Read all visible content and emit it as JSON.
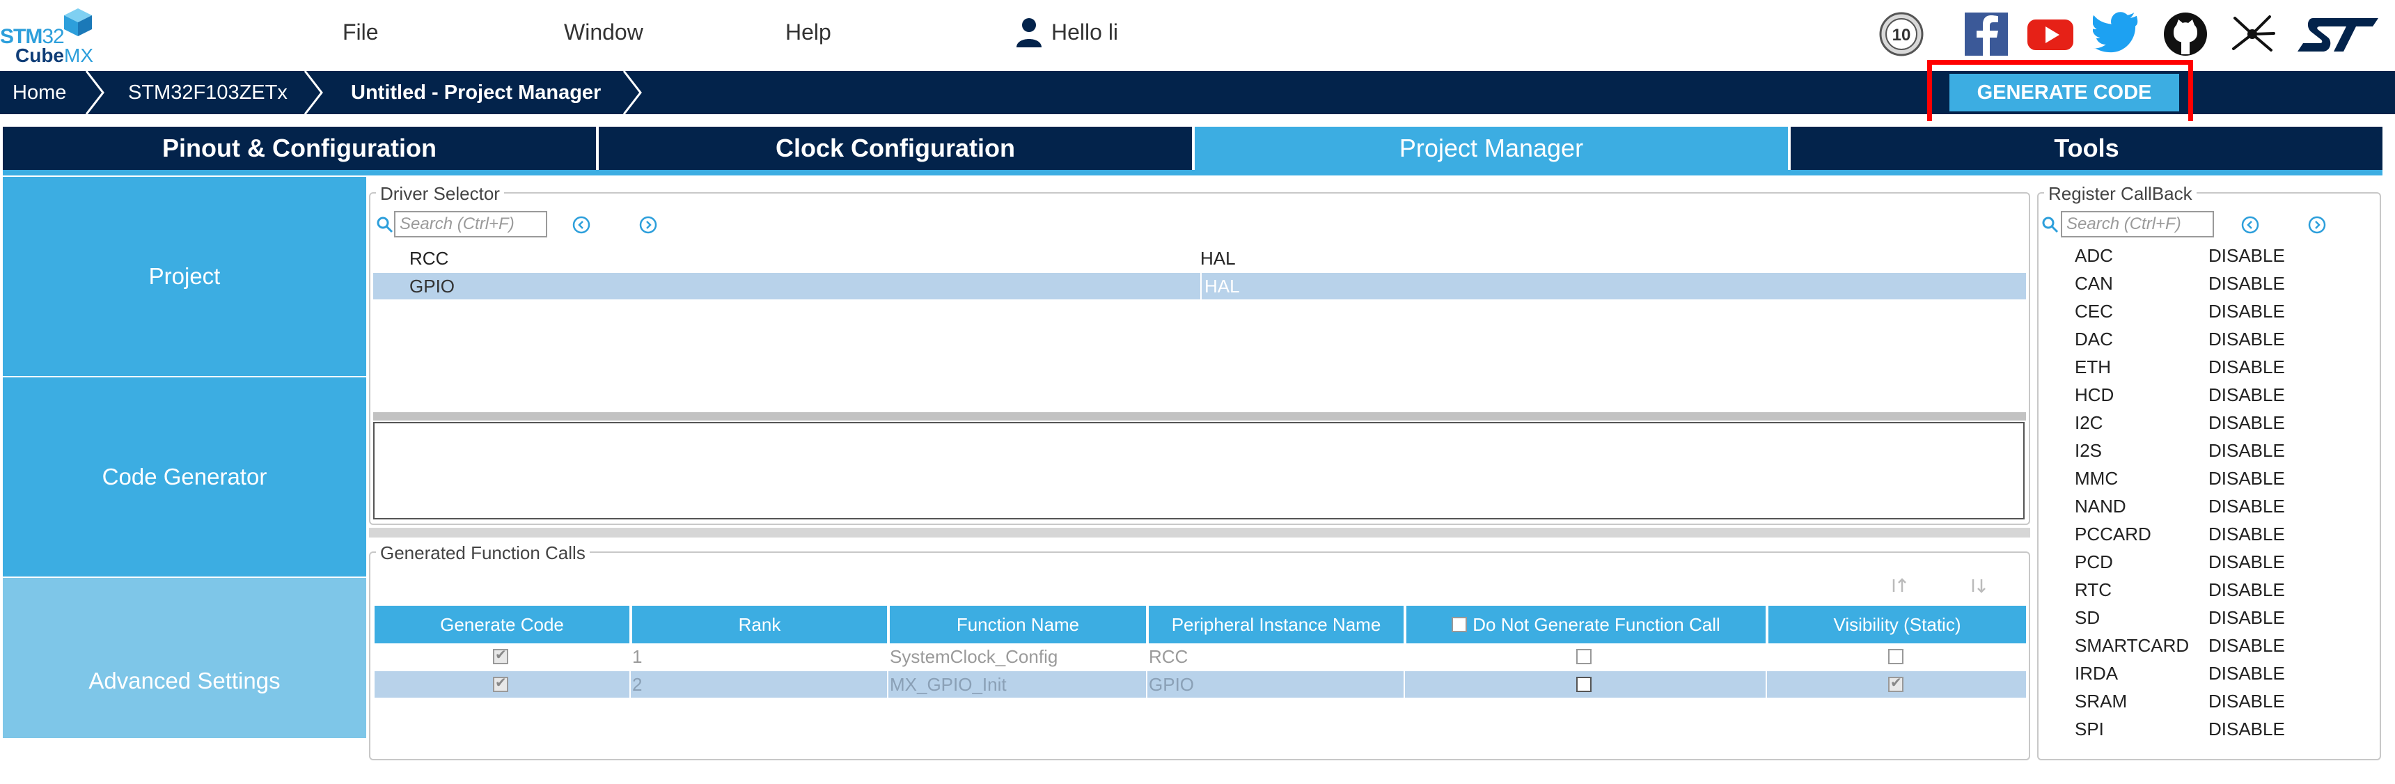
{
  "app": {
    "logo_line1_a": "STM",
    "logo_line1_b": "32",
    "logo_line2_a": "Cube",
    "logo_line2_b": "MX",
    "brand_color": "#3cade2",
    "dark_color": "#03234b"
  },
  "menu": {
    "file": "File",
    "window": "Window",
    "help": "Help",
    "user": "Hello li",
    "user_icon": "user-icon",
    "social_icons": [
      "anniversary-10-badge-icon",
      "facebook-icon",
      "youtube-icon",
      "twitter-icon",
      "github-icon",
      "network-share-icon",
      "st-logo-icon"
    ]
  },
  "breadcrumb": {
    "home": "Home",
    "mcu": "STM32F103ZETx",
    "project": "Untitled - Project Manager"
  },
  "generate_button": "GENERATE CODE",
  "tabs": [
    {
      "label": "Pinout & Configuration",
      "active": false
    },
    {
      "label": "Clock Configuration",
      "active": false
    },
    {
      "label": "Project Manager",
      "active": true
    },
    {
      "label": "Tools",
      "active": false
    }
  ],
  "sidebar": {
    "project": "Project",
    "code_generator": "Code Generator",
    "advanced_settings": "Advanced Settings"
  },
  "driver_selector": {
    "title": "Driver Selector",
    "search_placeholder": "Search (Ctrl+F)",
    "rows": [
      {
        "name": "RCC",
        "driver": "HAL",
        "selected": false
      },
      {
        "name": "GPIO",
        "driver": "HAL",
        "selected": true
      }
    ]
  },
  "generated_calls": {
    "title": "Generated Function Calls",
    "columns": [
      "Generate Code",
      "Rank",
      "Function Name",
      "Peripheral Instance Name",
      "Do Not Generate Function Call",
      "Visibility (Static)"
    ],
    "rows": [
      {
        "generate": true,
        "rank": "1",
        "function": "SystemClock_Config",
        "instance": "RCC",
        "do_not_generate": false,
        "visibility": false
      },
      {
        "generate": true,
        "rank": "2",
        "function": "MX_GPIO_Init",
        "instance": "GPIO",
        "do_not_generate": false,
        "visibility": true
      }
    ]
  },
  "register_callback": {
    "title": "Register CallBack",
    "search_placeholder": "Search (Ctrl+F)",
    "items": [
      {
        "name": "ADC",
        "value": "DISABLE"
      },
      {
        "name": "CAN",
        "value": "DISABLE"
      },
      {
        "name": "CEC",
        "value": "DISABLE"
      },
      {
        "name": "DAC",
        "value": "DISABLE"
      },
      {
        "name": "ETH",
        "value": "DISABLE"
      },
      {
        "name": "HCD",
        "value": "DISABLE"
      },
      {
        "name": "I2C",
        "value": "DISABLE"
      },
      {
        "name": "I2S",
        "value": "DISABLE"
      },
      {
        "name": "MMC",
        "value": "DISABLE"
      },
      {
        "name": "NAND",
        "value": "DISABLE"
      },
      {
        "name": "PCCARD",
        "value": "DISABLE"
      },
      {
        "name": "PCD",
        "value": "DISABLE"
      },
      {
        "name": "RTC",
        "value": "DISABLE"
      },
      {
        "name": "SD",
        "value": "DISABLE"
      },
      {
        "name": "SMARTCARD",
        "value": "DISABLE"
      },
      {
        "name": "IRDA",
        "value": "DISABLE"
      },
      {
        "name": "SRAM",
        "value": "DISABLE"
      },
      {
        "name": "SPI",
        "value": "DISABLE"
      }
    ]
  }
}
